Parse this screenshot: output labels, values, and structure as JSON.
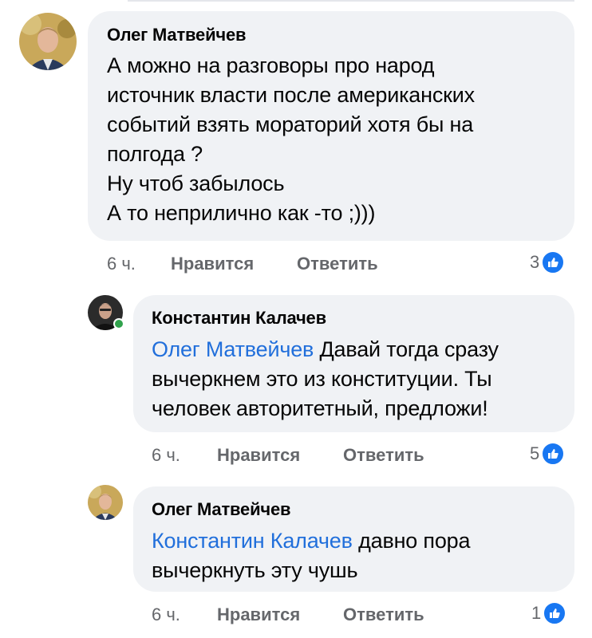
{
  "comments": [
    {
      "author": "Олег Матвейчев",
      "text": "А можно  на разговоры про народ\nисточник власти после американских\nсобытий  взять мораторий хотя бы на\nполгода ?\nНу чтоб забылось\n А то неприлично как -то ;)))",
      "time": "6 ч.",
      "like_label": "Нравится",
      "reply_label": "Ответить",
      "reactions": "3",
      "reaction_icon": "like-icon"
    },
    {
      "author": "Константин Калачев",
      "mention": "Олег Матвейчев",
      "text": " Давай тогда сразу\nвычеркнем это из конституции. Ты\nчеловек авторитетный, предложи!",
      "time": "6 ч.",
      "like_label": "Нравится",
      "reply_label": "Ответить",
      "reactions": "5",
      "reaction_icon": "like-icon",
      "online": true
    },
    {
      "author": "Олег Матвейчев",
      "mention": "Константин Калачев",
      "text": " давно пора\nвычеркнуть эту чушь",
      "time": "6 ч.",
      "like_label": "Нравится",
      "reply_label": "Ответить",
      "reactions": "1",
      "reaction_icon": "like-icon"
    }
  ],
  "colors": {
    "bubble": "#f0f2f5",
    "mention": "#216fdb",
    "meta": "#65676b",
    "like_blue": "#1877f2",
    "online": "#31a24c"
  }
}
